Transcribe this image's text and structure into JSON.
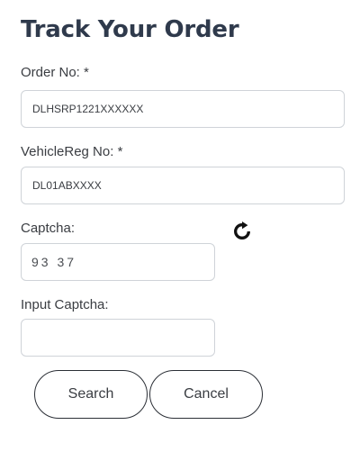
{
  "form": {
    "title": "Track Your Order",
    "order_no": {
      "label": "Order No: *",
      "placeholder": "DLHSRP1221XXXXXX"
    },
    "vehicle_reg": {
      "label": "VehicleReg No: *",
      "placeholder": "DL01ABXXXX"
    },
    "captcha": {
      "label": "Captcha:",
      "value": "93 37",
      "refresh_icon": "refresh-icon"
    },
    "input_captcha": {
      "label": "Input Captcha:",
      "value": ""
    },
    "buttons": {
      "search": "Search",
      "cancel": "Cancel"
    }
  },
  "colors": {
    "title": "#2f3a4c",
    "border": "#cfd3d8",
    "button_border": "#2b2f36"
  }
}
